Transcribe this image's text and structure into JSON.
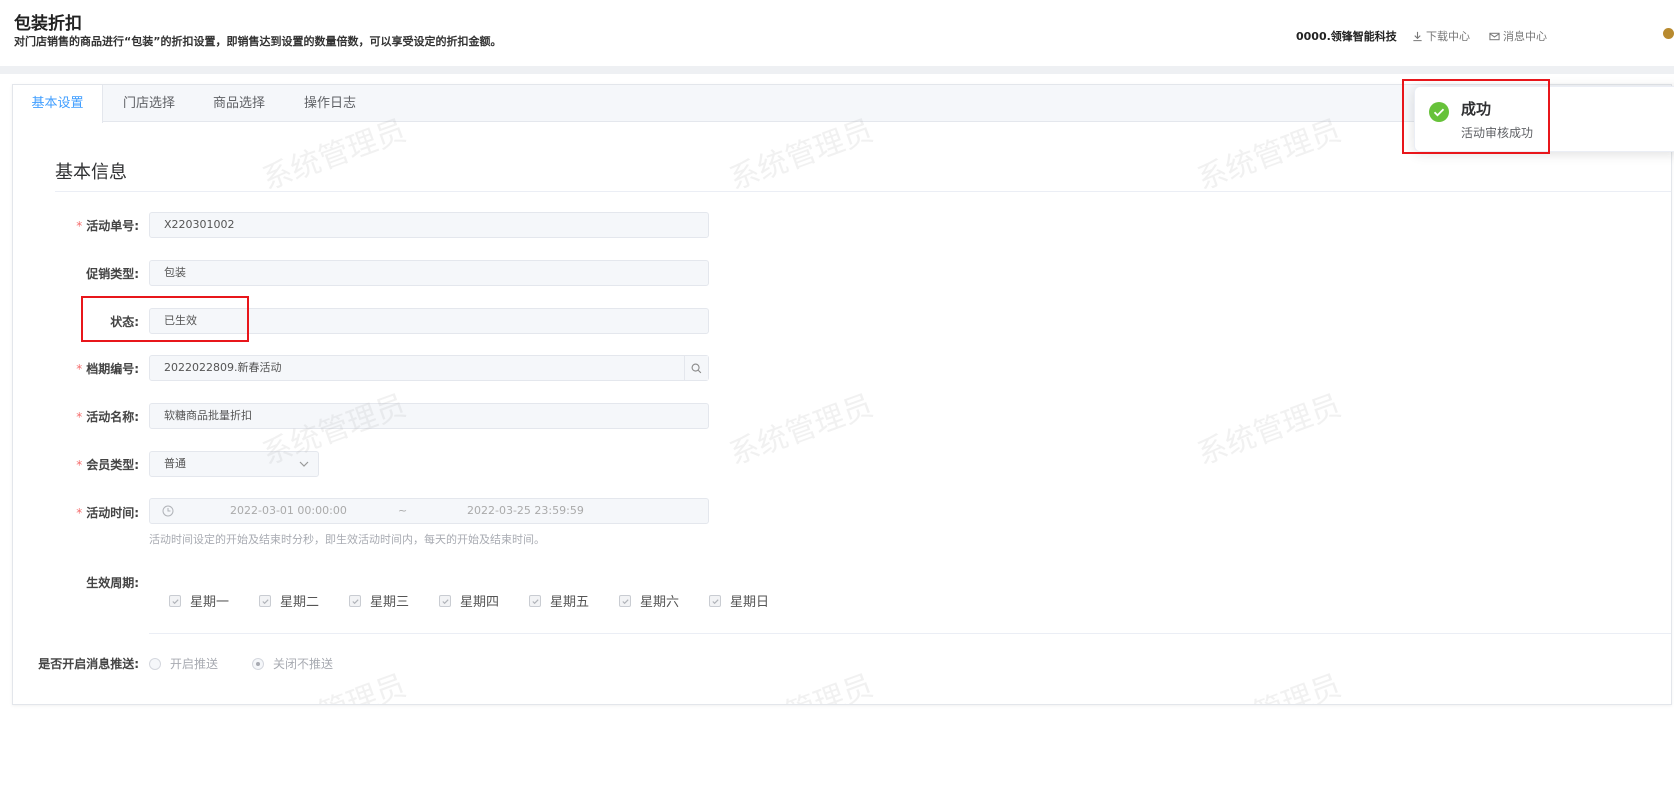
{
  "header": {
    "title": "包装折扣",
    "subtitle": "对门店销售的商品进行“包装”的折扣设置，即销售达到设置的数量倍数，可以享受设定的折扣金额。",
    "company": "0000.领锋智能科技",
    "download_center": "下载中心",
    "message_center": "消息中心"
  },
  "tabs": [
    {
      "label": "基本设置",
      "active": true
    },
    {
      "label": "门店选择",
      "active": false
    },
    {
      "label": "商品选择",
      "active": false
    },
    {
      "label": "操作日志",
      "active": false
    }
  ],
  "section": {
    "title": "基本信息"
  },
  "form": {
    "activity_no": {
      "label": "活动单号:",
      "value": "X220301002",
      "required": true
    },
    "promo_type": {
      "label": "促销类型:",
      "value": "包装",
      "required": false
    },
    "status": {
      "label": "状态:",
      "value": "已生效",
      "required": false
    },
    "period_no": {
      "label": "档期编号:",
      "value": "2022022809.新春活动",
      "required": true
    },
    "activity_name": {
      "label": "活动名称:",
      "value": "软糖商品批量折扣",
      "required": true
    },
    "member_type": {
      "label": "会员类型:",
      "value": "普通",
      "required": true
    },
    "activity_time": {
      "label": "活动时间:",
      "start": "2022-03-01 00:00:00",
      "separator": "~",
      "end": "2022-03-25 23:59:59",
      "hint": "活动时间设定的开始及结束时分秒，即生效活动时间内，每天的开始及结束时间。",
      "required": true
    },
    "cycle": {
      "label": "生效周期:",
      "days": [
        "星期一",
        "星期二",
        "星期三",
        "星期四",
        "星期五",
        "星期六",
        "星期日"
      ]
    },
    "push": {
      "label": "是否开启消息推送:",
      "options": [
        {
          "label": "开启推送",
          "selected": false
        },
        {
          "label": "关闭不推送",
          "selected": true
        }
      ]
    }
  },
  "notification": {
    "title": "成功",
    "message": "活动审核成功"
  },
  "watermark": "系统管理员",
  "colors": {
    "accent": "#409eff",
    "required": "#f56c6c",
    "success": "#67c23a",
    "highlight": "#e8161b"
  }
}
